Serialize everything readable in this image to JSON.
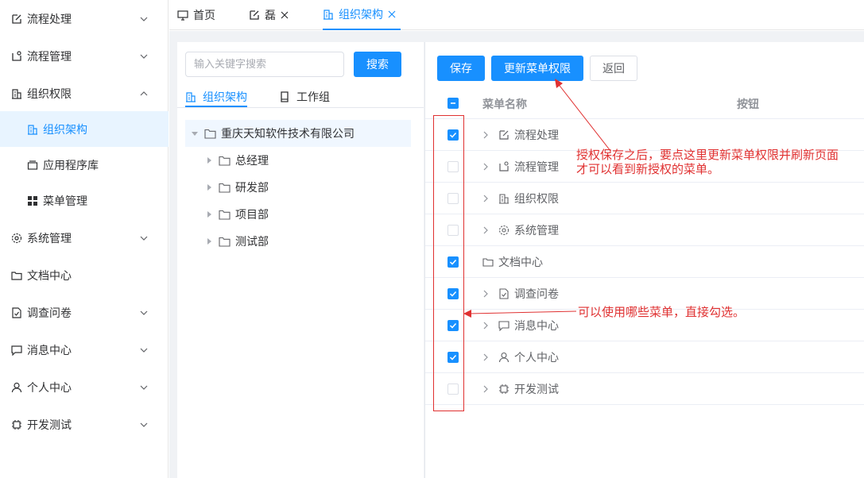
{
  "sidebar": {
    "items": [
      {
        "label": "流程处理"
      },
      {
        "label": "流程管理"
      },
      {
        "label": "组织权限"
      },
      {
        "label": "系统管理"
      },
      {
        "label": "文档中心"
      },
      {
        "label": "调查问卷"
      },
      {
        "label": "消息中心"
      },
      {
        "label": "个人中心"
      },
      {
        "label": "开发测试"
      }
    ],
    "sub_items": [
      {
        "label": "组织架构"
      },
      {
        "label": "应用程序库"
      },
      {
        "label": "菜单管理"
      }
    ]
  },
  "tabs": [
    {
      "label": "首页"
    },
    {
      "label": "磊"
    },
    {
      "label": "组织架构"
    }
  ],
  "left_panel": {
    "search": {
      "placeholder": "输入关键字搜索",
      "button_label": "搜索"
    },
    "tabs": [
      {
        "label": "组织架构"
      },
      {
        "label": "工作组"
      }
    ],
    "tree": {
      "root": "重庆天知软件技术有限公司",
      "children": [
        "总经理",
        "研发部",
        "项目部",
        "测试部"
      ]
    }
  },
  "right_panel": {
    "buttons": {
      "save": "保存",
      "update": "更新菜单权限",
      "back": "返回"
    },
    "columns": {
      "name": "菜单名称",
      "button": "按钮"
    },
    "rows": [
      {
        "label": "流程处理",
        "checked": true
      },
      {
        "label": "流程管理",
        "checked": false
      },
      {
        "label": "组织权限",
        "checked": false
      },
      {
        "label": "系统管理",
        "checked": false
      },
      {
        "label": "文档中心",
        "checked": true
      },
      {
        "label": "调查问卷",
        "checked": true
      },
      {
        "label": "消息中心",
        "checked": true
      },
      {
        "label": "个人中心",
        "checked": true
      },
      {
        "label": "开发测试",
        "checked": false
      }
    ]
  },
  "annotations": {
    "update_note_line1": "授权保存之后，要点这里更新菜单权限并刷新页面",
    "update_note_line2": "才可以看到新授权的菜单。",
    "select_note": "可以使用哪些菜单，直接勾选。"
  },
  "colors": {
    "accent": "#1890ff",
    "annotation": "#e03131"
  }
}
